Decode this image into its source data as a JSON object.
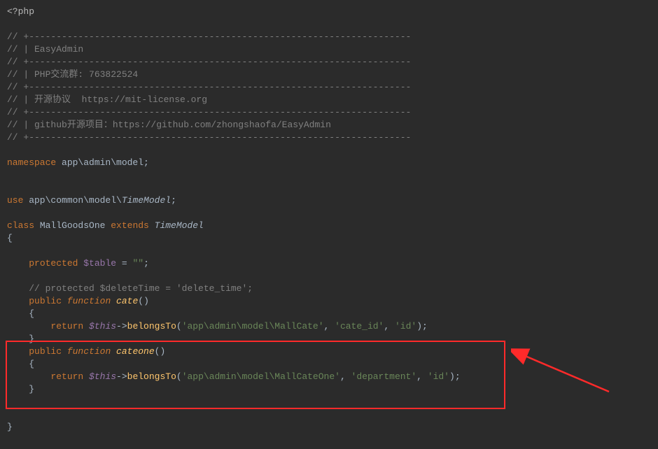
{
  "code": {
    "php_open": "<?php",
    "c1": "// +----------------------------------------------------------------------",
    "c2": "// | EasyAdmin",
    "c3": "// +----------------------------------------------------------------------",
    "c4": "// | PHP交流群: 763822524",
    "c5": "// +----------------------------------------------------------------------",
    "c6": "// | 开源协议  https://mit-license.org",
    "c7": "// +----------------------------------------------------------------------",
    "c8": "// | github开源项目：https://github.com/zhongshaofa/EasyAdmin",
    "c9": "// +----------------------------------------------------------------------",
    "kw_namespace": "namespace",
    "ns_path": " app\\admin\\model;",
    "kw_use": "use",
    "use_path": " app\\common\\model\\",
    "use_type": "TimeModel",
    "semi": ";",
    "kw_class": "class",
    "cls_name": " MallGoodsOne ",
    "kw_extends": "extends",
    "ext_type": " TimeModel",
    "brace_open": "{",
    "kw_protected": "protected",
    "var_table": " $table",
    "eq": " = ",
    "str_empty": "\"\"",
    "comment_deleteTime": "// protected $deleteTime = 'delete_time';",
    "kw_public": "public",
    "kw_function": " function",
    "fn_cate": " cate",
    "parens": "()",
    "indent1": "    ",
    "indent2": "        ",
    "kw_return": "return",
    "var_this": " $this",
    "arrow": "->",
    "fn_belongsTo": "belongsTo",
    "lp": "(",
    "rp": ")",
    "str_mallcate": "'app\\admin\\model\\MallCate'",
    "comma_sp": ", ",
    "str_cateid": "'cate_id'",
    "str_id": "'id'",
    "fn_cateone": " cateone",
    "str_mallcateone": "'app\\admin\\model\\MallCateOne'",
    "str_department": "'department'",
    "brace_close": "}"
  }
}
